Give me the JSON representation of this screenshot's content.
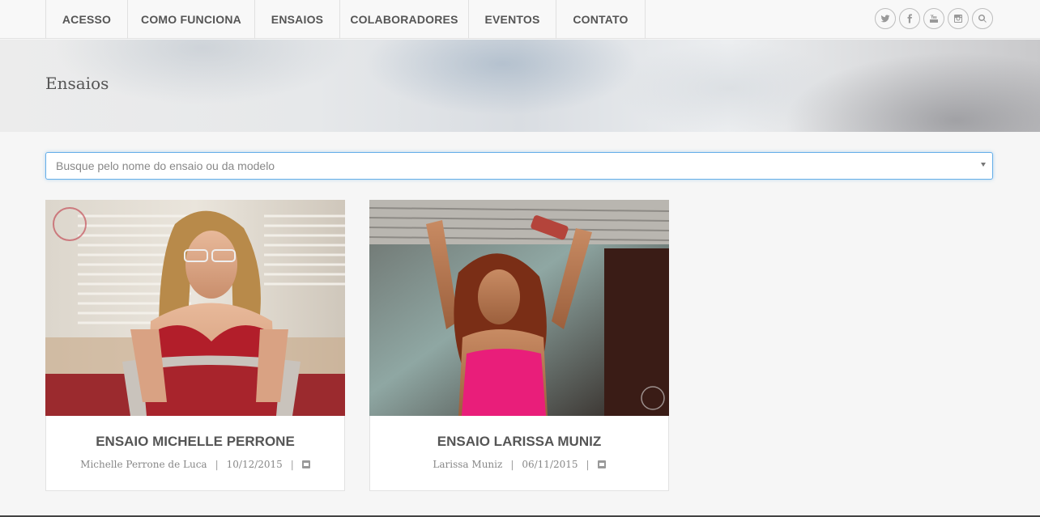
{
  "nav": {
    "items": [
      {
        "label": "ACESSO"
      },
      {
        "label": "COMO FUNCIONA"
      },
      {
        "label": "ENSAIOS"
      },
      {
        "label": "COLABORADORES"
      },
      {
        "label": "EVENTOS"
      },
      {
        "label": "CONTATO"
      }
    ],
    "social_icons": [
      "twitter-icon",
      "facebook-icon",
      "youtube-icon",
      "instagram-icon",
      "search-icon"
    ]
  },
  "hero": {
    "title": "Ensaios"
  },
  "search": {
    "placeholder": "Busque pelo nome do ensaio ou da modelo",
    "value": ""
  },
  "cards": [
    {
      "title": "ENSAIO MICHELLE PERRONE",
      "model": "Michelle Perrone de Luca",
      "date": "10/12/2015",
      "separator": "|"
    },
    {
      "title": "ENSAIO LARISSA MUNIZ",
      "model": "Larissa Muniz",
      "date": "06/11/2015",
      "separator": "|"
    }
  ],
  "colors": {
    "accent_border": "#66afe9",
    "text": "#555555",
    "muted": "#888888",
    "background": "#f6f6f6"
  }
}
